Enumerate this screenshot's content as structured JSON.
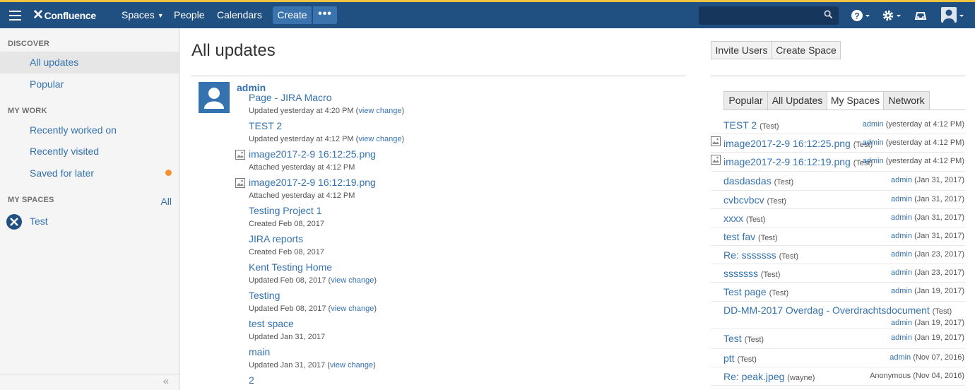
{
  "header": {
    "logo": "Confluence",
    "nav": [
      "Spaces",
      "People",
      "Calendars"
    ],
    "create": "Create",
    "more": "•••"
  },
  "sidebar": {
    "discover": "DISCOVER",
    "all_updates": "All updates",
    "popular": "Popular",
    "my_work": "MY WORK",
    "recently_worked": "Recently worked on",
    "recently_visited": "Recently visited",
    "saved_for_later": "Saved for later",
    "my_spaces": "MY SPACES",
    "all": "All",
    "space": "Test",
    "collapse": "«"
  },
  "main": {
    "title": "All updates",
    "author": "admin",
    "entries": [
      {
        "title": "Page - JIRA Macro",
        "meta": "Updated yesterday at 4:20 PM (",
        "link": "view change",
        "end": ")",
        "icon": false
      },
      {
        "title": "TEST 2",
        "meta": "Updated yesterday at 4:12 PM (",
        "link": "view change",
        "end": ")",
        "icon": false
      },
      {
        "title": "image2017-2-9 16:12:25.png",
        "meta": "Attached yesterday at 4:12 PM",
        "link": "",
        "end": "",
        "icon": true
      },
      {
        "title": "image2017-2-9 16:12:19.png",
        "meta": "Attached yesterday at 4:12 PM",
        "link": "",
        "end": "",
        "icon": true
      },
      {
        "title": "Testing Project 1",
        "meta": "Created Feb 08, 2017",
        "link": "",
        "end": "",
        "icon": false
      },
      {
        "title": "JIRA reports",
        "meta": "Created Feb 08, 2017",
        "link": "",
        "end": "",
        "icon": false
      },
      {
        "title": "Kent Testing Home",
        "meta": "Updated Feb 08, 2017 (",
        "link": "view change",
        "end": ")",
        "icon": false
      },
      {
        "title": "Testing",
        "meta": "Updated Feb 08, 2017 (",
        "link": "view change",
        "end": ")",
        "icon": false
      },
      {
        "title": "test space",
        "meta": "Updated Jan 31, 2017",
        "link": "",
        "end": "",
        "icon": false
      },
      {
        "title": "main",
        "meta": "Updated Jan 31, 2017 (",
        "link": "view change",
        "end": ")",
        "icon": false
      },
      {
        "title": "2",
        "meta": "",
        "link": "",
        "end": "",
        "icon": false
      }
    ]
  },
  "right": {
    "invite": "Invite Users",
    "create_space": "Create Space",
    "tabs": [
      "Popular",
      "All Updates",
      "My Spaces",
      "Network"
    ],
    "active_tab": "My Spaces",
    "rows": [
      {
        "title": "TEST 2",
        "space": "(Test)",
        "user": "admin",
        "when": "(yesterday at 4:12 PM)",
        "icon": false
      },
      {
        "title": "image2017-2-9 16:12:25.png",
        "space": "(Test)",
        "user": "admin",
        "when": "(yesterday at 4:12 PM)",
        "icon": true
      },
      {
        "title": "image2017-2-9 16:12:19.png",
        "space": "(Test)",
        "user": "admin",
        "when": "(yesterday at 4:12 PM)",
        "icon": true
      },
      {
        "title": "dasdasdas",
        "space": "(Test)",
        "user": "admin",
        "when": "(Jan 31, 2017)",
        "icon": false
      },
      {
        "title": "cvbcvbcv",
        "space": "(Test)",
        "user": "admin",
        "when": "(Jan 31, 2017)",
        "icon": false
      },
      {
        "title": "xxxx",
        "space": "(Test)",
        "user": "admin",
        "when": "(Jan 31, 2017)",
        "icon": false
      },
      {
        "title": "test fav",
        "space": "(Test)",
        "user": "admin",
        "when": "(Jan 31, 2017)",
        "icon": false
      },
      {
        "title": "Re: sssssss",
        "space": "(Test)",
        "user": "admin",
        "when": "(Jan 23, 2017)",
        "icon": false
      },
      {
        "title": "sssssss",
        "space": "(Test)",
        "user": "admin",
        "when": "(Jan 23, 2017)",
        "icon": false
      },
      {
        "title": "Test page",
        "space": "(Test)",
        "user": "admin",
        "when": "(Jan 19, 2017)",
        "icon": false
      },
      {
        "title": "DD-MM-2017 Overdag - Overdrachtsdocument",
        "space": "(Test)",
        "user": "admin",
        "when": "(Jan 19, 2017)",
        "icon": false
      },
      {
        "title": "Test",
        "space": "(Test)",
        "user": "admin",
        "when": "(Jan 19, 2017)",
        "icon": false
      },
      {
        "title": "ptt",
        "space": "(Test)",
        "user": "admin",
        "when": "(Nov 07, 2016)",
        "icon": false
      },
      {
        "title": "Re: peak.jpeg",
        "space": "(wayne)",
        "user": "",
        "when": "Anonymous (Nov 04, 2016)",
        "icon": false
      }
    ]
  }
}
